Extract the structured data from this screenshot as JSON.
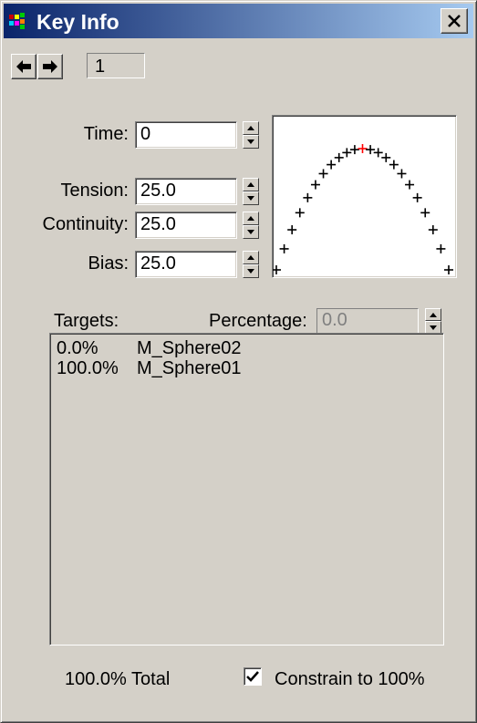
{
  "window": {
    "title": "Key Info",
    "close_glyph": "×"
  },
  "nav": {
    "prev_icon": "arrow-left",
    "next_icon": "arrow-right",
    "key_number": "1"
  },
  "params": {
    "time_label": "Time:",
    "time_value": "0",
    "tension_label": "Tension:",
    "tension_value": "25.0",
    "continuity_label": "Continuity:",
    "continuity_value": "25.0",
    "bias_label": "Bias:",
    "bias_value": "25.0"
  },
  "targets": {
    "label": "Targets:",
    "percentage_label": "Percentage:",
    "percentage_value": "0.0",
    "items": [
      {
        "percent": "0.0%",
        "name": "M_Sphere02"
      },
      {
        "percent": "100.0%",
        "name": "M_Sphere01"
      }
    ]
  },
  "footer": {
    "total": "100.0% Total",
    "constrain_label": "Constrain to 100%",
    "constrain_checked": true
  },
  "colors": {
    "title_start": "#0a246a",
    "title_end": "#a6caf0",
    "face": "#d4d0c8",
    "key_marker": "#ff0000"
  }
}
